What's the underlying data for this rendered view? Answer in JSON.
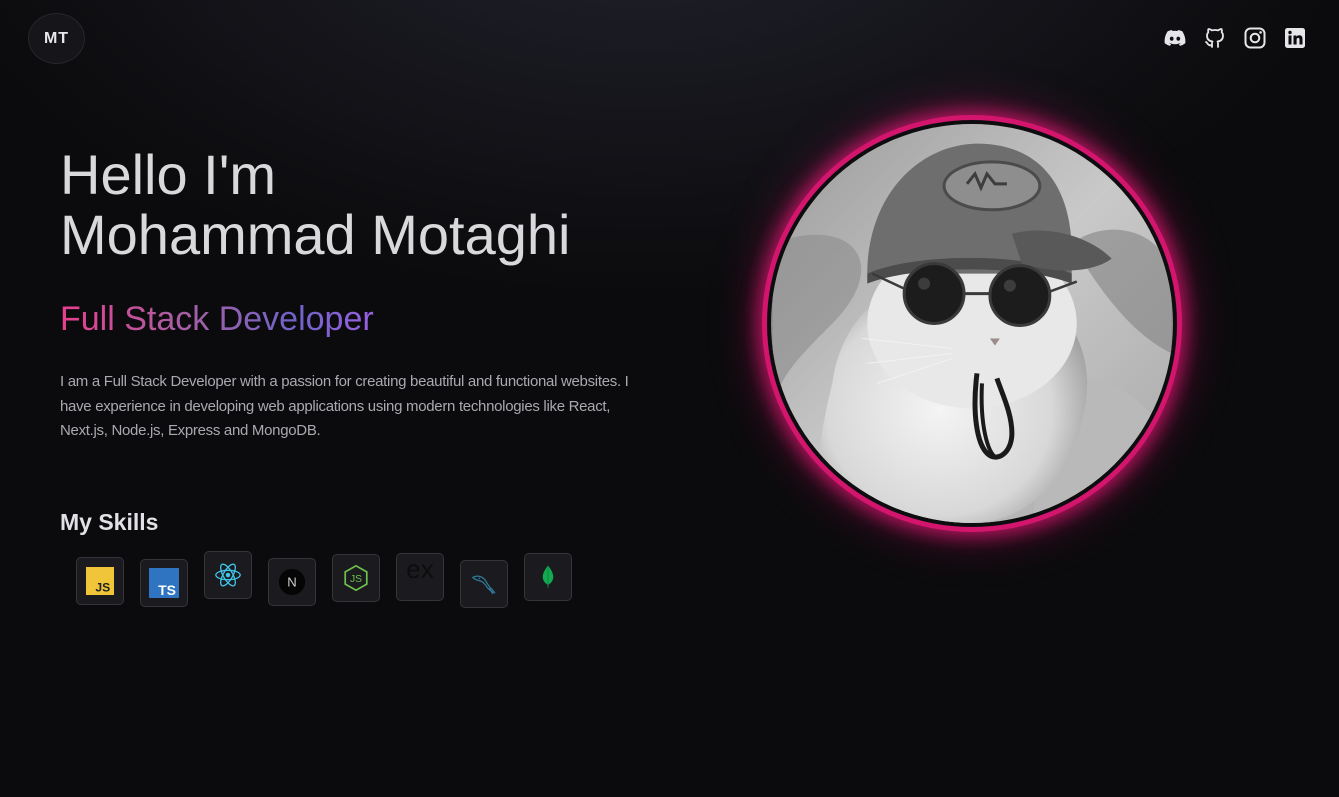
{
  "header": {
    "logo_text": "MT",
    "socials": [
      {
        "name": "Discord",
        "icon": "discord-icon"
      },
      {
        "name": "GitHub",
        "icon": "github-icon"
      },
      {
        "name": "Instagram",
        "icon": "instagram-icon"
      },
      {
        "name": "LinkedIn",
        "icon": "linkedin-icon"
      }
    ]
  },
  "hero": {
    "greeting": "Hello I'm",
    "name": "Mohammad Motaghi",
    "role": "Full Stack Developer",
    "bio": "  I am a Full Stack Developer with a passion for creating beautiful and functional websites. I have experience in developing web applications using modern technologies like React, Next.js, Node.js, Express and MongoDB."
  },
  "skills": {
    "title": "My Skills",
    "items": [
      {
        "icon": "javascript-icon",
        "label": "JS"
      },
      {
        "icon": "typescript-icon",
        "label": "TS"
      },
      {
        "icon": "react-icon"
      },
      {
        "icon": "nextjs-icon",
        "label": "N"
      },
      {
        "icon": "nodejs-icon",
        "label": "JS"
      },
      {
        "icon": "express-icon",
        "label": "ex"
      },
      {
        "icon": "mysql-icon"
      },
      {
        "icon": "mongodb-icon"
      }
    ]
  },
  "avatar": {
    "icon": "profile-photo-cat"
  },
  "colors": {
    "accent_pink": "#d4156e",
    "role_gradient": [
      "#ea3f8f",
      "#6f63c8",
      "#9a5fe0"
    ],
    "background": "#0b0b0e"
  }
}
